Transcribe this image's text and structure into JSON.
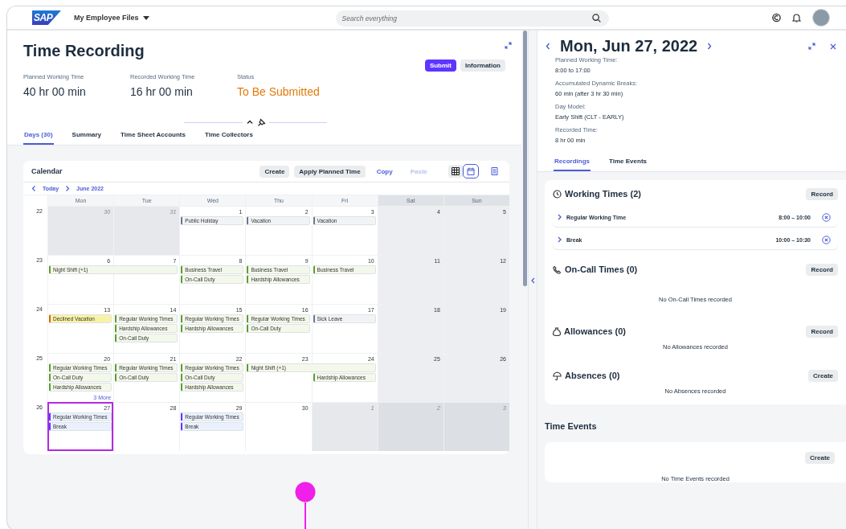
{
  "shell": {
    "logo": "SAP",
    "product": "My Employee Files",
    "search": {
      "placeholder": "Search everything"
    }
  },
  "page": {
    "title": "Time Recording",
    "actions": [
      {
        "label": "Submit",
        "kind": "primary"
      },
      {
        "label": "Information",
        "kind": "default"
      }
    ],
    "kpis": [
      {
        "label": "Planned Working Time",
        "value": "40 hr 00 min",
        "kind": "neutral"
      },
      {
        "label": "Recorded Working Time",
        "value": "16 hr 00 min",
        "kind": "neutral"
      },
      {
        "label": "Status",
        "value": "To Be Submitted",
        "kind": "warning"
      }
    ],
    "tabs": [
      {
        "label": "Days (30)",
        "selected": true
      },
      {
        "label": "Summary",
        "selected": false
      },
      {
        "label": "Time Sheet Accounts",
        "selected": false
      },
      {
        "label": "Time Collectors",
        "selected": false
      }
    ]
  },
  "calendar": {
    "title": "Calendar",
    "actions": [
      {
        "label": "Create",
        "kind": "button",
        "disabled": false
      },
      {
        "label": "Apply Planned Time",
        "kind": "button",
        "disabled": false
      },
      {
        "label": "Copy",
        "kind": "link",
        "disabled": false
      },
      {
        "label": "Paste",
        "kind": "link",
        "disabled": true
      }
    ],
    "views": [
      {
        "kind": "grid",
        "selected": false
      },
      {
        "kind": "calendar",
        "selected": true
      },
      {
        "kind": "list",
        "selected": false
      }
    ],
    "today": "Today",
    "month": "June 2022",
    "weekdays": [
      {
        "label": "Mon",
        "weekend": false
      },
      {
        "label": "Tue",
        "weekend": false
      },
      {
        "label": "Wed",
        "weekend": false
      },
      {
        "label": "Thu",
        "weekend": false
      },
      {
        "label": "Fri",
        "weekend": false
      },
      {
        "label": "Sat",
        "weekend": true
      },
      {
        "label": "Sun",
        "weekend": true
      }
    ],
    "weeks": [
      {
        "number": "22",
        "days": [
          {
            "date": "30",
            "outside": true,
            "selected": false
          },
          {
            "date": "31",
            "outside": true,
            "selected": false
          },
          {
            "date": "1",
            "outside": false,
            "selected": false,
            "events": [
              {
                "label": "Public Holiday",
                "kind": "absence",
                "multi_day": false
              }
            ]
          },
          {
            "date": "2",
            "outside": false,
            "selected": false,
            "events": [
              {
                "label": "Vacation",
                "kind": "absence",
                "multi_day": false
              }
            ]
          },
          {
            "date": "3",
            "outside": false,
            "selected": false,
            "events": [
              {
                "label": "Vacation",
                "kind": "absence",
                "multi_day": false
              }
            ]
          },
          {
            "date": "4",
            "outside": false,
            "selected": false
          },
          {
            "date": "5",
            "outside": false,
            "selected": false
          }
        ]
      },
      {
        "number": "23",
        "days": [
          {
            "date": "6",
            "outside": false,
            "selected": false,
            "events": [
              {
                "label": "Night Shift (+1)",
                "kind": "approved",
                "multi_day": true
              }
            ]
          },
          {
            "date": "7",
            "outside": false,
            "selected": false
          },
          {
            "date": "8",
            "outside": false,
            "selected": false,
            "events": [
              {
                "label": "Business Travel",
                "kind": "approved",
                "multi_day": false
              },
              {
                "label": "On-Call Duty",
                "kind": "approved",
                "multi_day": false
              }
            ]
          },
          {
            "date": "9",
            "outside": false,
            "selected": false,
            "events": [
              {
                "label": "Business Travel",
                "kind": "approved",
                "multi_day": false
              },
              {
                "label": "Hardship Allowances",
                "kind": "approved",
                "multi_day": false
              }
            ]
          },
          {
            "date": "10",
            "outside": false,
            "selected": false,
            "events": [
              {
                "label": "Business Travel",
                "kind": "approved",
                "multi_day": false
              }
            ]
          },
          {
            "date": "11",
            "outside": false,
            "selected": false
          },
          {
            "date": "12",
            "outside": false,
            "selected": false
          }
        ]
      },
      {
        "number": "24",
        "days": [
          {
            "date": "13",
            "outside": false,
            "selected": false,
            "events": [
              {
                "label": "Declined Vacation",
                "kind": "declined",
                "multi_day": false
              }
            ]
          },
          {
            "date": "14",
            "outside": false,
            "selected": false,
            "events": [
              {
                "label": "Regular Working Times",
                "kind": "approved",
                "multi_day": false
              },
              {
                "label": "Hardship Allowances",
                "kind": "approved",
                "multi_day": false
              },
              {
                "label": "On-Call Duty",
                "kind": "approved",
                "multi_day": false
              }
            ]
          },
          {
            "date": "15",
            "outside": false,
            "selected": false,
            "events": [
              {
                "label": "Regular Working Times",
                "kind": "approved",
                "multi_day": false
              },
              {
                "label": "Hardship Allowances",
                "kind": "approved",
                "multi_day": false
              }
            ]
          },
          {
            "date": "16",
            "outside": false,
            "selected": false,
            "events": [
              {
                "label": "Regular Working Times",
                "kind": "approved",
                "multi_day": false
              },
              {
                "label": "On-Call Duty",
                "kind": "approved",
                "multi_day": false
              }
            ]
          },
          {
            "date": "17",
            "outside": false,
            "selected": false,
            "events": [
              {
                "label": "Sick Leave",
                "kind": "absence",
                "multi_day": false
              }
            ]
          },
          {
            "date": "18",
            "outside": false,
            "selected": false
          },
          {
            "date": "19",
            "outside": false,
            "selected": false
          }
        ]
      },
      {
        "number": "25",
        "days": [
          {
            "date": "20",
            "outside": false,
            "selected": false,
            "more": "3 More",
            "events": [
              {
                "label": "Regular Working Times",
                "kind": "approved",
                "multi_day": false
              },
              {
                "label": "On-Call Duty",
                "kind": "approved",
                "multi_day": false
              },
              {
                "label": "Hardship Allowances",
                "kind": "approved",
                "multi_day": false
              }
            ]
          },
          {
            "date": "21",
            "outside": false,
            "selected": false,
            "events": [
              {
                "label": "Regular Working Times",
                "kind": "approved",
                "multi_day": false
              },
              {
                "label": "On-Call Duty",
                "kind": "approved",
                "multi_day": false
              }
            ]
          },
          {
            "date": "22",
            "outside": false,
            "selected": false,
            "events": [
              {
                "label": "Regular Working Times",
                "kind": "approved",
                "multi_day": false
              },
              {
                "label": "On-Call Duty",
                "kind": "approved",
                "multi_day": false
              },
              {
                "label": "Hardship Allowances",
                "kind": "approved",
                "multi_day": false
              }
            ]
          },
          {
            "date": "23",
            "outside": false,
            "selected": false,
            "events": [
              {
                "label": "Night Shift (+1)",
                "kind": "approved",
                "multi_day": true
              }
            ]
          },
          {
            "date": "24",
            "outside": false,
            "selected": false,
            "events": [
              {
                "label": "Hardship Allowances",
                "kind": "approved",
                "multi_day": false
              }
            ]
          },
          {
            "date": "25",
            "outside": false,
            "selected": false
          },
          {
            "date": "26",
            "outside": false,
            "selected": false
          }
        ]
      },
      {
        "number": "26",
        "days": [
          {
            "date": "27",
            "outside": false,
            "selected": true,
            "events": [
              {
                "label": "Regular Working Times",
                "kind": "recorded",
                "multi_day": false
              },
              {
                "label": "Break",
                "kind": "recorded",
                "multi_day": false
              }
            ]
          },
          {
            "date": "28",
            "outside": false,
            "selected": false
          },
          {
            "date": "29",
            "outside": false,
            "selected": false,
            "events": [
              {
                "label": "Regular Working Times",
                "kind": "recorded",
                "multi_day": false
              },
              {
                "label": "Break",
                "kind": "recorded",
                "multi_day": false
              }
            ]
          },
          {
            "date": "30",
            "outside": false,
            "selected": false
          },
          {
            "date": "1",
            "outside": true,
            "selected": false
          },
          {
            "date": "2",
            "outside": true,
            "selected": false
          },
          {
            "date": "3",
            "outside": true,
            "selected": false
          }
        ]
      }
    ]
  },
  "detail": {
    "date": "Mon, Jun 27, 2022",
    "fields": [
      {
        "label": "Planned Working Time:",
        "value": "8:00 to 17:00"
      },
      {
        "label": "Accumulated Dynamic Breaks:",
        "value": "60 min (after 3 hr 30 min)"
      },
      {
        "label": "Day Model:",
        "value": "Early Shift (CLT - EARLY)"
      },
      {
        "label": "Recorded Time:",
        "value": "8 hr 00 min"
      }
    ],
    "tabs": [
      {
        "label": "Recordings",
        "selected": true
      },
      {
        "label": "Time Events",
        "selected": false
      }
    ],
    "sections": [
      {
        "kind": "working",
        "title": "Working Times (2)",
        "action": "Record",
        "items": [
          {
            "label": "Regular Working Time",
            "time": "8:00 – 10:00"
          },
          {
            "label": "Break",
            "time": "10:00 – 10:30"
          }
        ]
      },
      {
        "kind": "oncall",
        "title": "On-Call Times (0)",
        "action": "Record",
        "empty": "No On-Call Times recorded"
      },
      {
        "kind": "allowance",
        "title": "Allowances (0)",
        "action": "Record",
        "empty": "No Allowances recorded"
      },
      {
        "kind": "absence",
        "title": "Absences (0)",
        "action": "Create",
        "empty": "No Absences recorded"
      }
    ],
    "time_events": {
      "title": "Time Events",
      "action": "Create",
      "empty": "No Time Events recorded"
    }
  }
}
